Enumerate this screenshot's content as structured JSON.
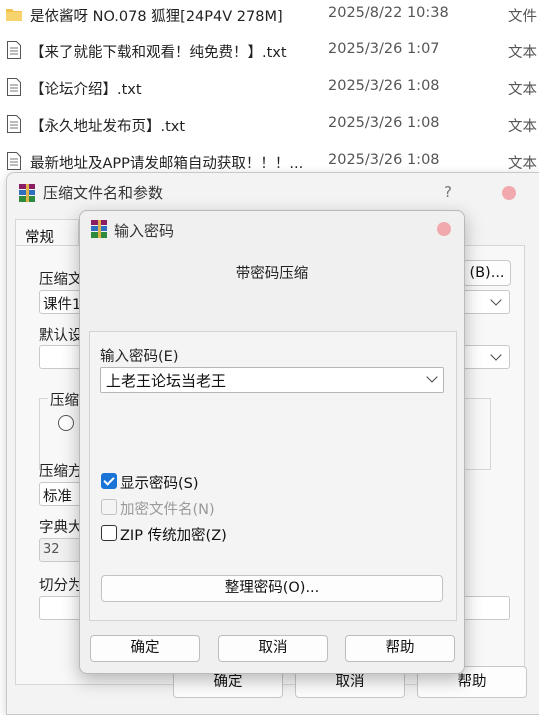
{
  "files": [
    {
      "name": "是依酱呀 NO.078 狐狸[24P4V 278M]",
      "date": "2025/8/22 10:38",
      "type": "文件",
      "icon": "folder-icon"
    },
    {
      "name": "【来了就能下载和观看！纯免费！】.txt",
      "date": "2025/3/26 1:07",
      "type": "文本",
      "icon": "text-file-icon"
    },
    {
      "name": "【论坛介绍】.txt",
      "date": "2025/3/26 1:08",
      "type": "文本",
      "icon": "text-file-icon"
    },
    {
      "name": "【永久地址发布页】.txt",
      "date": "2025/3/26 1:08",
      "type": "文本",
      "icon": "text-file-icon"
    },
    {
      "name": "最新地址及APP请发邮箱自动获取！！！...",
      "date": "2025/3/26 1:08",
      "type": "文本",
      "icon": "text-file-icon"
    }
  ],
  "archive_dialog": {
    "title": "压缩文件名和参数",
    "help": "?",
    "tab_general": "常规",
    "archive_name_label": "压缩文",
    "archive_name_value": "课件1",
    "browse_button": "(B)...",
    "default_label": "默认设",
    "format_label": "压缩",
    "method_label": "压缩方",
    "method_value": "标准",
    "dict_label": "字典大",
    "dict_value": "32",
    "split_label": "切分为",
    "ok": "确定",
    "cancel": "取消",
    "help_button": "帮助"
  },
  "password_dialog": {
    "title": "输入密码",
    "heading": "带密码压缩",
    "password_label": "输入密码(E)",
    "password_value": "上老王论坛当老王",
    "show_password": "显示密码(S)",
    "encrypt_names": "加密文件名(N)",
    "zip_legacy": "ZIP 传统加密(Z)",
    "organize": "整理密码(O)...",
    "ok": "确定",
    "cancel": "取消",
    "help": "帮助"
  },
  "colors": {
    "accent": "#1a73d6",
    "close_dot": "#f1a9ad",
    "folder": "#f2c14e"
  }
}
